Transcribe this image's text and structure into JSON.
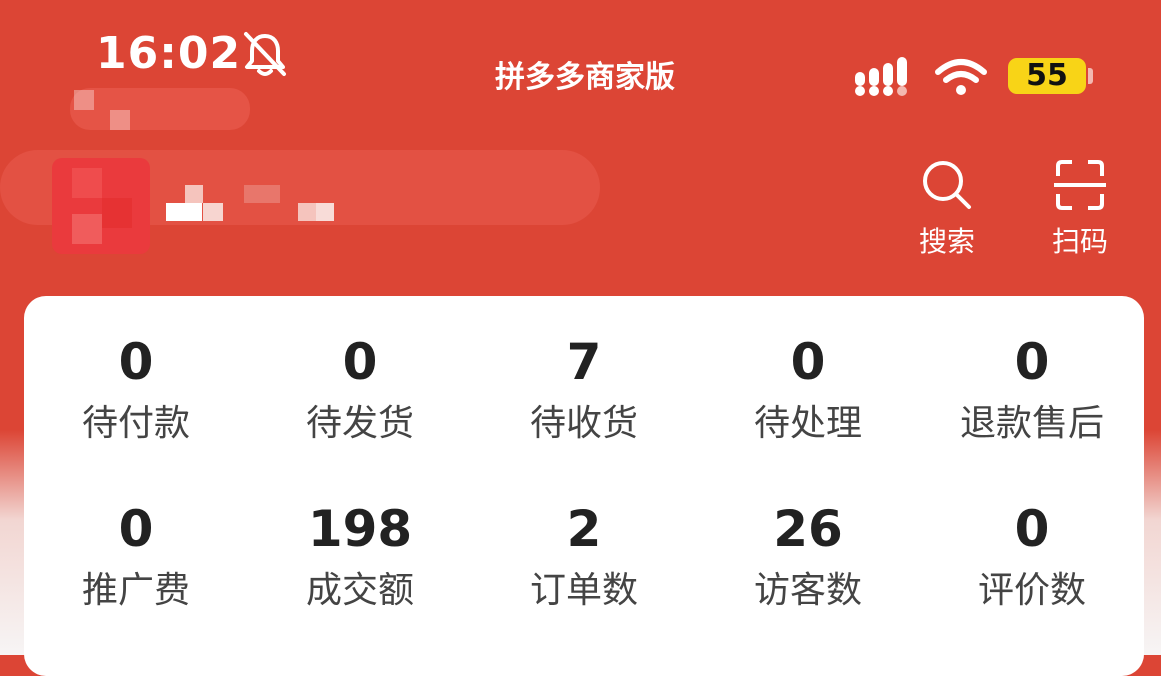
{
  "status_bar": {
    "time": "16:02",
    "app_name": "拼多多商家版",
    "battery": "55"
  },
  "tools": [
    {
      "label": "搜索",
      "icon": "search-icon"
    },
    {
      "label": "扫码",
      "icon": "scan-icon"
    }
  ],
  "colors": {
    "header": "#dc4535",
    "battery": "#f8d417",
    "card": "#ffffff"
  },
  "stats_row1": [
    {
      "value": "0",
      "label": "待付款"
    },
    {
      "value": "0",
      "label": "待发货"
    },
    {
      "value": "7",
      "label": "待收货"
    },
    {
      "value": "0",
      "label": "待处理"
    },
    {
      "value": "0",
      "label": "退款售后"
    }
  ],
  "stats_row2": [
    {
      "value": "0",
      "label": "推广费"
    },
    {
      "value": "198",
      "label": "成交额"
    },
    {
      "value": "2",
      "label": "订单数"
    },
    {
      "value": "26",
      "label": "访客数"
    },
    {
      "value": "0",
      "label": "评价数"
    }
  ]
}
